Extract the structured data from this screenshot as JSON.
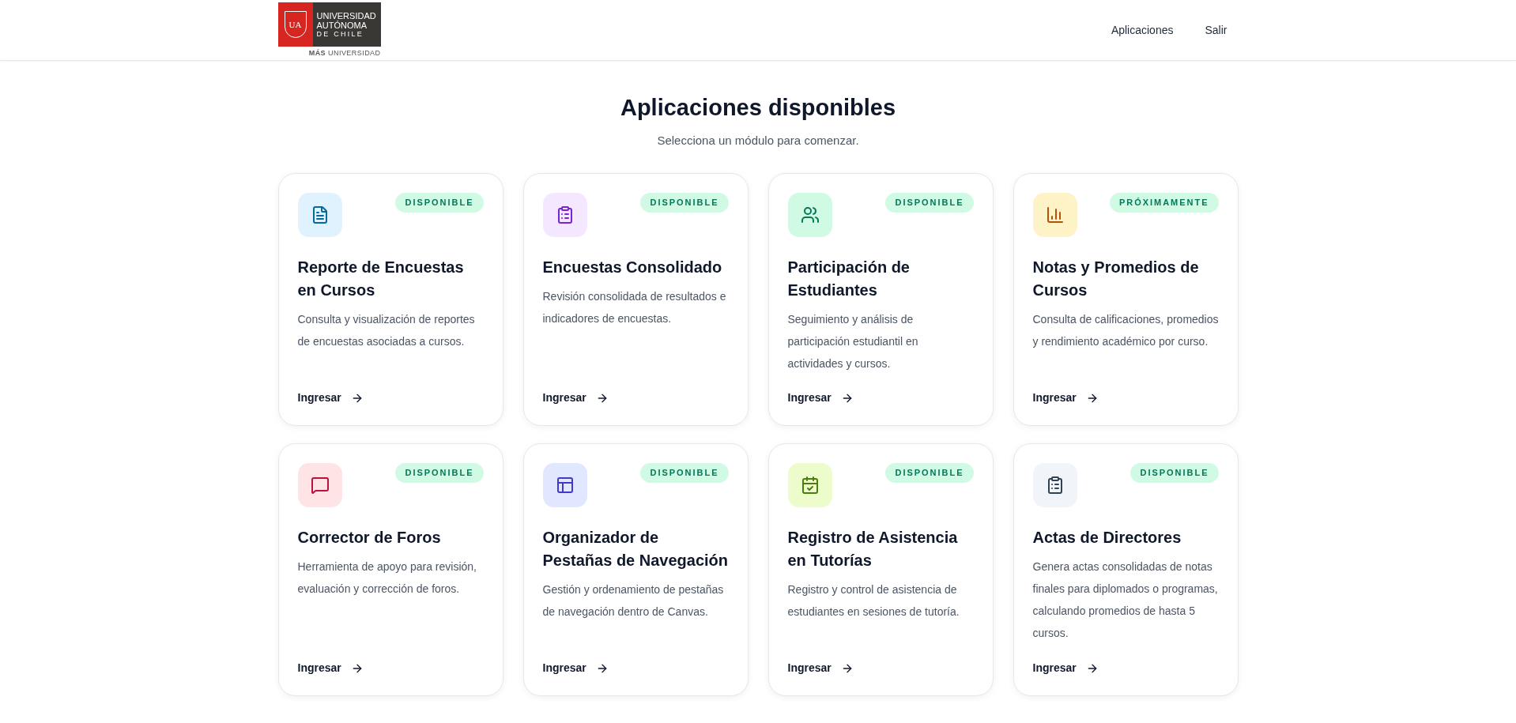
{
  "header": {
    "logo": {
      "name_lines": [
        "UNIVERSIDAD",
        "AUTÓNOMA",
        "DE CHILE"
      ],
      "monogram": "UA",
      "tagline": "**MÁS** UNIVERSIDAD"
    },
    "nav": [
      "Aplicaciones",
      "Salir"
    ]
  },
  "title": "Aplicaciones disponibles",
  "subtitle": "Selecciona un módulo para comenzar.",
  "cards": [
    {
      "kind": "report",
      "badge": "DISPONIBLE",
      "title": "Reporte de Encuestas en Cursos",
      "description": "Consulta y visualización de reportes de encuestas asociadas a cursos.",
      "link": "Ingresar"
    },
    {
      "kind": "survey",
      "badge": "DISPONIBLE",
      "title": "Encuestas Consolidado",
      "description": "Revisión consolidada de resultados e indicadores de encuestas.",
      "link": "Ingresar"
    },
    {
      "kind": "students",
      "badge": "DISPONIBLE",
      "title": "Participación de Estudiantes",
      "description": "Seguimiento y análisis de participación estudiantil en actividades y cursos.",
      "link": "Ingresar"
    },
    {
      "kind": "grades",
      "badge": "PRÓXIMAMENTE",
      "title": "Notas y Promedios de Cursos",
      "description": "Consulta de calificaciones, promedios y rendimiento académico por curso.",
      "link": "Ingresar"
    },
    {
      "kind": "forum",
      "badge": "DISPONIBLE",
      "title": "Corrector de Foros",
      "description": "Herramienta de apoyo para revisión, evaluación y corrección de foros.",
      "link": "Ingresar"
    },
    {
      "kind": "tabs",
      "badge": "DISPONIBLE",
      "title": "Organizador de Pestañas de Navegación",
      "description": "Gestión y ordenamiento de pestañas de navegación dentro de Canvas.",
      "link": "Ingresar"
    },
    {
      "kind": "attendance",
      "badge": "DISPONIBLE",
      "title": "Registro de Asistencia en Tutorías",
      "description": "Registro y control de asistencia de estudiantes en sesiones de tutoría.",
      "link": "Ingresar"
    },
    {
      "kind": "minutes",
      "badge": "DISPONIBLE",
      "title": "Actas de Directores",
      "description": "Genera actas consolidadas de notas finales para diplomados o programas, calculando promedios de hasta 5 cursos.",
      "link": "Ingresar"
    }
  ]
}
